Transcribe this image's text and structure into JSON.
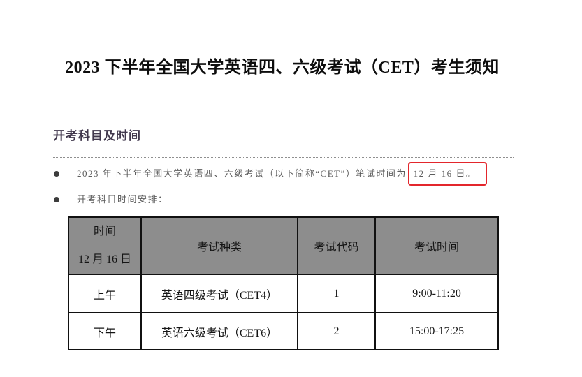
{
  "document": {
    "title": "2023 下半年全国大学英语四、六级考试（CET）考生须知"
  },
  "section": {
    "heading": "开考科目及时间",
    "bullets": [
      {
        "text": "2023 年下半年全国大学英语四、六级考试（以下简称“CET”）笔试时间为 ",
        "highlight": "12 月 16 日。"
      },
      {
        "text": "开考科目时间安排："
      }
    ]
  },
  "schedule_table": {
    "header": {
      "time_label": "时间",
      "date": "12 月 16 日",
      "exam_type": "考试种类",
      "exam_code": "考试代码",
      "exam_time": "考试时间"
    },
    "rows": [
      {
        "period": "上午",
        "exam": "英语四级考试（CET4）",
        "code": "1",
        "time": "9:00-11:20"
      },
      {
        "period": "下午",
        "exam": "英语六级考试（CET6）",
        "code": "2",
        "time": "15:00-17:25"
      }
    ]
  },
  "icons": {
    "bullet": "bullet-dot-icon"
  },
  "colors": {
    "heading": "#41384d",
    "highlight_border": "#e3262c",
    "table_header_bg": "#8d8d8d"
  }
}
